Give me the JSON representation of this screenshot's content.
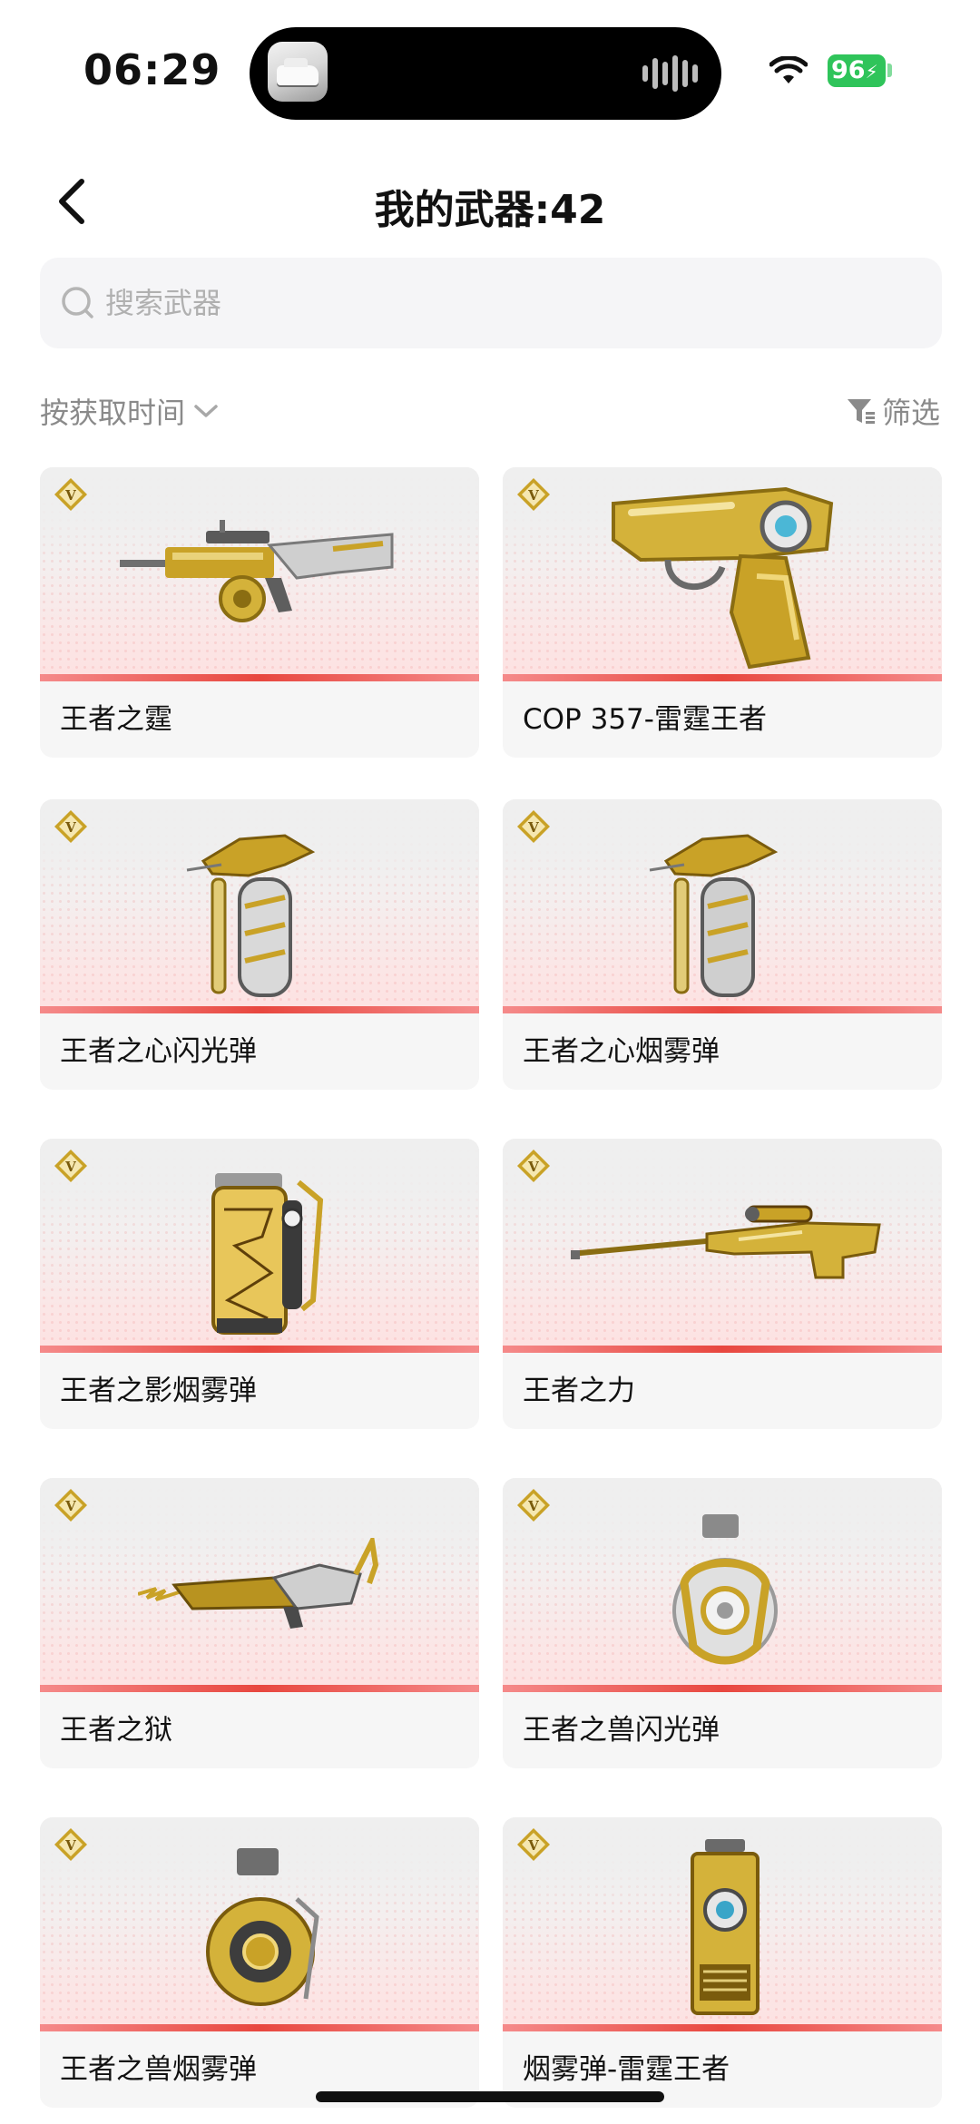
{
  "status_bar": {
    "time": "06:29",
    "battery": "96"
  },
  "header": {
    "title": "我的武器:42"
  },
  "search": {
    "placeholder": "搜索武器"
  },
  "toolbar": {
    "sort_label": "按获取时间",
    "filter_label": "筛选"
  },
  "colors": {
    "accent_red": "#e8473f",
    "badge_gold": "#c9a227",
    "battery_green": "#2fc45a"
  },
  "weapons": [
    {
      "name": "王者之霆",
      "icon": "assault-rifle-icon"
    },
    {
      "name": "COP 357-雷霆王者",
      "icon": "pistol-icon"
    },
    {
      "name": "王者之心闪光弹",
      "icon": "flash-grenade-icon"
    },
    {
      "name": "王者之心烟雾弹",
      "icon": "smoke-grenade-icon"
    },
    {
      "name": "王者之影烟雾弹",
      "icon": "smoke-canister-icon"
    },
    {
      "name": "王者之力",
      "icon": "sniper-rifle-icon"
    },
    {
      "name": "王者之狱",
      "icon": "dragon-rifle-icon"
    },
    {
      "name": "王者之兽闪光弹",
      "icon": "round-flash-grenade-icon"
    },
    {
      "name": "王者之兽烟雾弹",
      "icon": "round-smoke-grenade-icon"
    },
    {
      "name": "烟雾弹-雷霆王者",
      "icon": "thunder-smoke-grenade-icon"
    }
  ]
}
